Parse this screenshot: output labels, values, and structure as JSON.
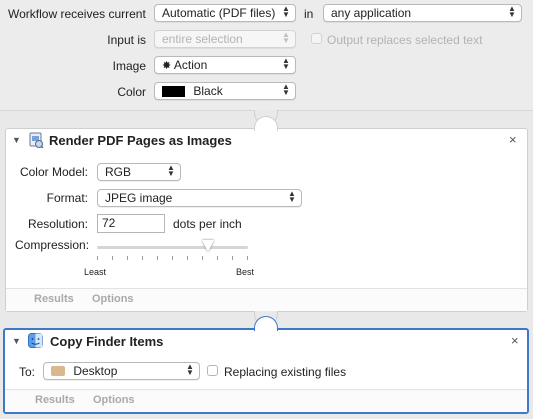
{
  "header": {
    "receives_label": "Workflow receives current",
    "receives_value": "Automatic (PDF files)",
    "in_label": "in",
    "in_value": "any application",
    "input_is_label": "Input is",
    "input_is_value": "entire selection",
    "output_replaces_label": "Output replaces selected text",
    "image_label": "Image",
    "image_value": "Action",
    "color_label": "Color",
    "color_value": "Black",
    "color_swatch": "#000000"
  },
  "render_action": {
    "title": "Render PDF Pages as Images",
    "icon": "preview-render-icon",
    "color_model_label": "Color Model:",
    "color_model_value": "RGB",
    "format_label": "Format:",
    "format_value": "JPEG image",
    "resolution_label": "Resolution:",
    "resolution_value": "72",
    "resolution_unit": "dots per inch",
    "compression_label": "Compression:",
    "compression_level": 0.74,
    "compression_min_label": "Least",
    "compression_max_label": "Best",
    "results_tab": "Results",
    "options_tab": "Options"
  },
  "copy_action": {
    "title": "Copy Finder Items",
    "icon": "finder-icon",
    "to_label": "To:",
    "to_value": "Desktop",
    "replacing_label": "Replacing existing files",
    "results_tab": "Results",
    "options_tab": "Options"
  },
  "colors": {
    "selection_border": "#3f78c8"
  }
}
